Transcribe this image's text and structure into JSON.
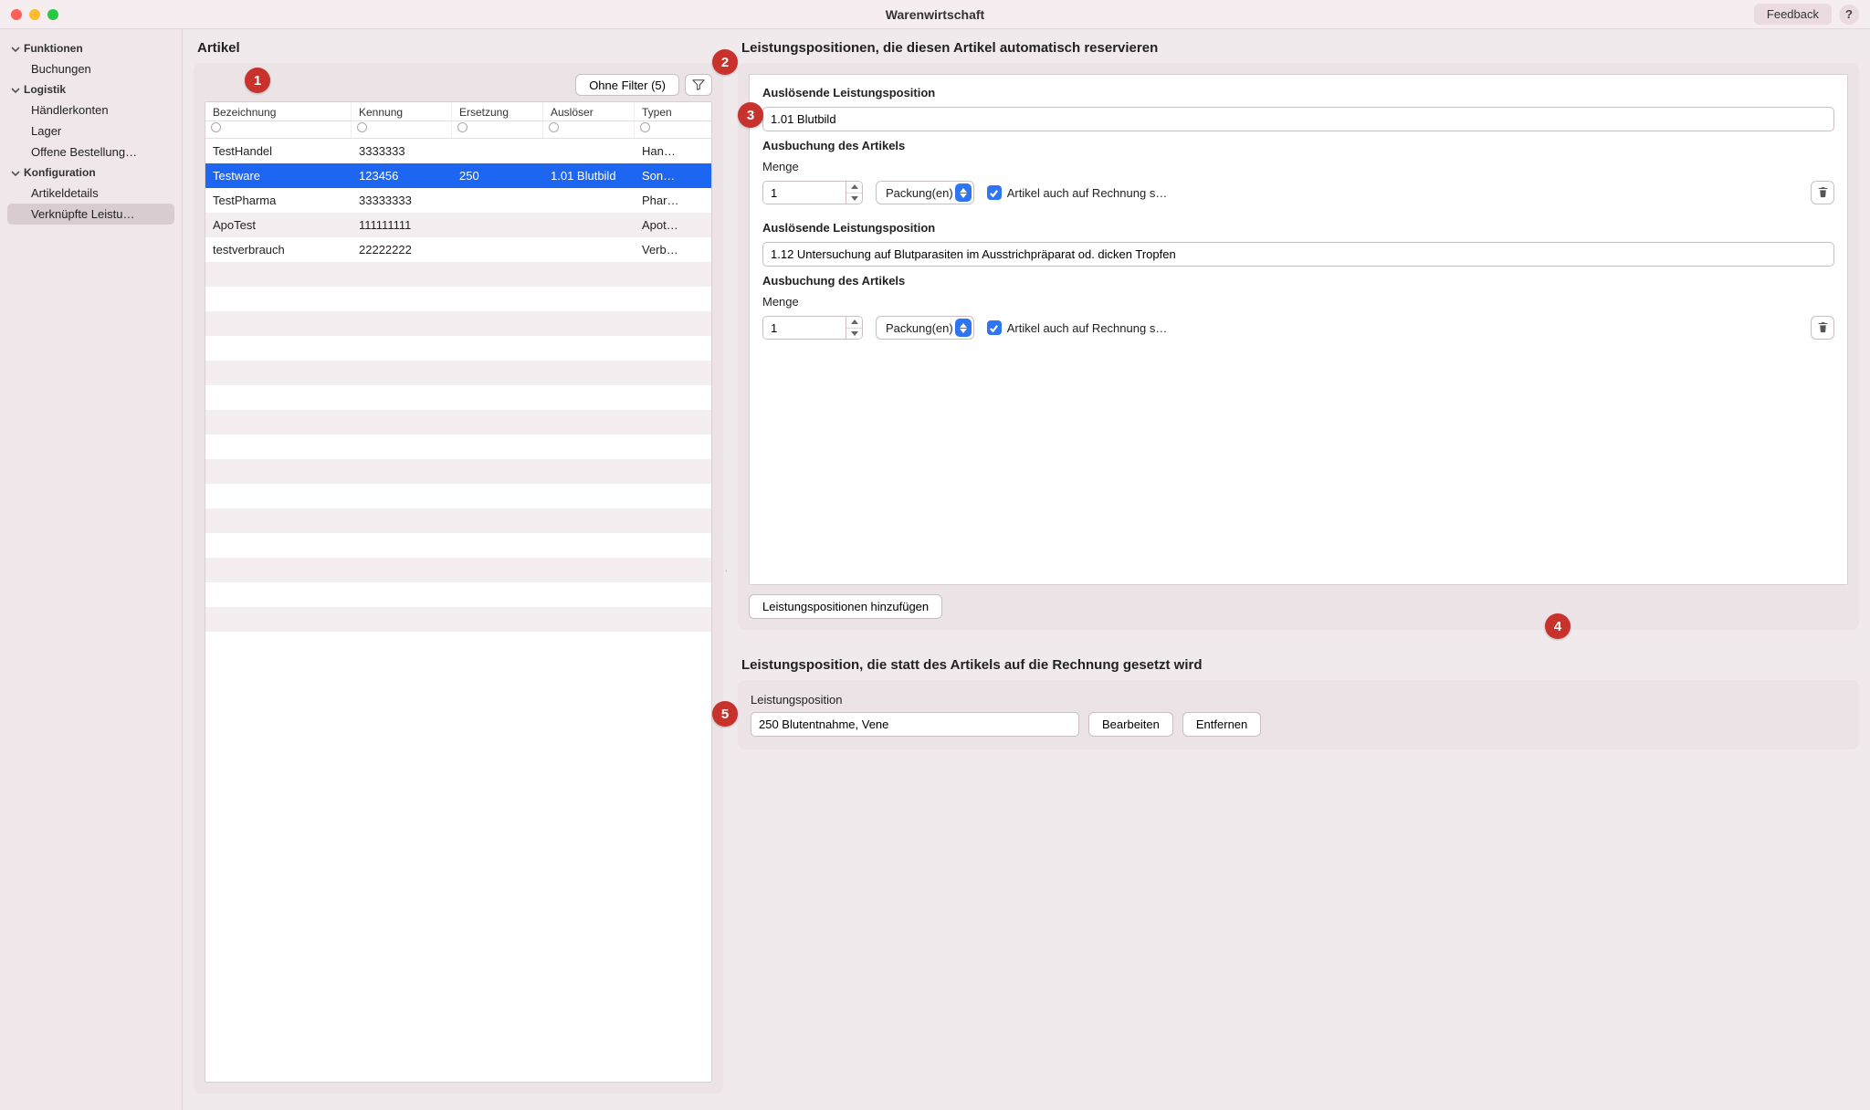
{
  "window": {
    "title": "Warenwirtschaft"
  },
  "titlebar": {
    "feedback": "Feedback",
    "help": "?"
  },
  "sidebar": {
    "groups": [
      {
        "label": "Funktionen",
        "items": [
          "Buchungen"
        ]
      },
      {
        "label": "Logistik",
        "items": [
          "Händlerkonten",
          "Lager",
          "Offene Bestellung…"
        ]
      },
      {
        "label": "Konfiguration",
        "items": [
          "Artikeldetails",
          "Verknüpfte Leistu…"
        ],
        "selectedIndex": 1
      }
    ]
  },
  "left": {
    "title": "Artikel",
    "filterLabel": "Ohne Filter (5)",
    "columns": [
      "Bezeichnung",
      "Kennung",
      "Ersetzung",
      "Auslöser",
      "Typen"
    ],
    "rows": [
      {
        "bez": "TestHandel",
        "ken": "3333333",
        "ers": "",
        "aus": "",
        "typ": "Han…"
      },
      {
        "bez": "Testware",
        "ken": "123456",
        "ers": "250",
        "aus": "1.01 Blutbild",
        "typ": "Son…",
        "selected": true
      },
      {
        "bez": "TestPharma",
        "ken": "33333333",
        "ers": "",
        "aus": "",
        "typ": "Phar…"
      },
      {
        "bez": "ApoTest",
        "ken": "111111111",
        "ers": "",
        "aus": "",
        "typ": "Apot…"
      },
      {
        "bez": "testverbrauch",
        "ken": "22222222",
        "ers": "",
        "aus": "",
        "typ": "Verb…"
      }
    ]
  },
  "right": {
    "title": "Leistungspositionen, die diesen Artikel automatisch reservieren",
    "triggerLabel": "Auslösende Leistungsposition",
    "bookingLabel": "Ausbuchung des Artikels",
    "qtyLabel": "Menge",
    "unit": "Packung(en)",
    "invoiceCheckbox": "Artikel auch auf Rechnung s…",
    "groups": [
      {
        "trigger": "1.01 Blutbild",
        "qty": "1"
      },
      {
        "trigger": "1.12 Untersuchung auf Blutparasiten im Ausstrichpräparat od. dicken Tropfen",
        "qty": "1"
      }
    ],
    "addButton": "Leistungspositionen hinzufügen"
  },
  "bottom": {
    "title": "Leistungsposition, die statt des Artikels auf die Rechnung gesetzt wird",
    "fieldLabel": "Leistungsposition",
    "value": "250 Blutentnahme, Vene",
    "editBtn": "Bearbeiten",
    "removeBtn": "Entfernen"
  },
  "badges": {
    "b1": "1",
    "b2": "2",
    "b3": "3",
    "b4": "4",
    "b5": "5"
  }
}
